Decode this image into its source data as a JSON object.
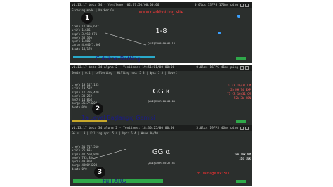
{
  "watermark": "www.darkbotting.site",
  "shots": [
    {
      "topbar_left": "v1.13.17 beta 34 - Yenileme: 02:57:50/00:00:00",
      "topbar_right": "0.0lcs  13FPS  170ms ping",
      "subbar": "Escaping mode | Marker Gu",
      "stats": "cre/h 12,956,642\nuri/h 1,686\nexp/h 3,913,671\nhon/h 35,350\nnpc/h 1,880\ncargo 4,640/1,860\ndeath 18/170",
      "level": "1-8",
      "timer": "ÇALIŞIYOR 00:02:18",
      "overlay": "Cubikon Botting",
      "marker": "1",
      "right_lines": [
        {
          "text": "",
          "color": "#9fc"
        }
      ]
    },
    {
      "topbar_left": "v1.13.17 beta 34 alpha 2 - Yenileme: 19:51:01/00:00:00",
      "topbar_right": "0.0lcs  16FPS  41ms ping",
      "subbar": "Genie | 0.4 | collecting | Killing npc: 5 3 | Npc: 5 3 | Wave 3/20",
      "stats": "cre/h 13,117,163\nuri/h 13,532\nexp/h 12,226,470\nhon/h 33,252\nnpc/h 11,064\ncargo 3647/4200\ndeath 0/0",
      "level": "GG κ",
      "timer": "ÇALIŞIYOR 00:00:00",
      "overlay": "1a Level Başlangıç Gemisi",
      "marker": "2",
      "right_lines": [
        {
          "text": "32 CR 16/31 CM",
          "color": "#ff5a5a"
        },
        {
          "text": "2b NH 74 EXP",
          "color": "#ff5a5a"
        },
        {
          "text": "77 CR 16/31 CM",
          "color": "#ff5a5a"
        },
        {
          "text": "52k 3b HON",
          "color": "#ff5a5a"
        }
      ]
    },
    {
      "topbar_left": "v1.13.17 beta 34 alpha 2 - Yenileme: 18:30:25/00:00:00",
      "topbar_right": "3.0lcs  19FPS  46ms ping",
      "subbar": "GG α | 0 | Killing npc: 5 4 | Npc: 5 4 | Wave 36/40",
      "stats": "cre/h 31,717,510\nuri/h 75,661\nexp/h 47,550,820\nhon/h 733,834\nnpc/h 43,050\ncargo 4300/4200\ndeath 0/0",
      "level": "GG α",
      "timer": "ÇALIŞIYOR 45:27:51",
      "overlay": "Full ARG",
      "marker": "3",
      "right_lines": [
        {
          "text": "18m 10k NM",
          "color": "#ffffff"
        },
        {
          "text": "1bs 10k",
          "color": "#ffffff"
        }
      ],
      "red_label": "m Damage fix: 500"
    }
  ],
  "colors": {
    "screen_bg": "#2b2f2d",
    "overlay_green": "#2fa84a",
    "overlay_cyan": "#29a9c9",
    "marker_bg": "#111111",
    "watermark_red": "#ff3b3b"
  }
}
